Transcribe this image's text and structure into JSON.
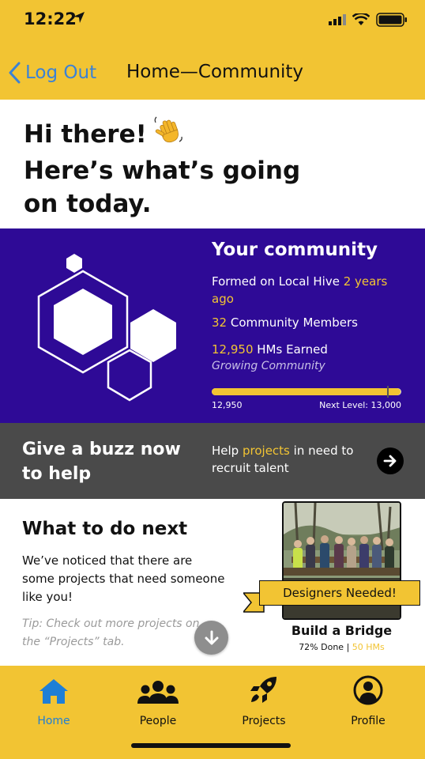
{
  "status_bar": {
    "time": "12:22"
  },
  "nav": {
    "back_label": "Log Out",
    "title": "Home—Community"
  },
  "greeting": {
    "line1": "Hi there!",
    "line2": "Here’s what’s going",
    "line3": "on today."
  },
  "community": {
    "title": "Your community",
    "formed_prefix": "Formed on Local Hive",
    "formed_age": "2 years ago",
    "members_count": "32",
    "members_label": "Community Members",
    "hms_count": "12,950",
    "hms_label": "HMs Earned",
    "status": "Growing Community",
    "progress_current": "12,950",
    "progress_next": "Next Level: 13,000",
    "progress_fraction": 0.9962
  },
  "buzz": {
    "title": "Give a buzz now to help",
    "text_prefix": "Help",
    "text_link": "projects",
    "text_suffix": "in need to recruit talent"
  },
  "next": {
    "title": "What to do next",
    "body": "We’ve noticed that there are some projects that need someone like you!",
    "tip": "Tip: Check out more projects on the “Projects” tab."
  },
  "project": {
    "ribbon": "Designers Needed!",
    "name": "Build a Bridge",
    "done": "72% Done",
    "separator": "|",
    "hms": "50 HMs"
  },
  "tabs": [
    {
      "label": "Home",
      "icon": "home-icon"
    },
    {
      "label": "People",
      "icon": "people-icon"
    },
    {
      "label": "Projects",
      "icon": "rocket-icon"
    },
    {
      "label": "Profile",
      "icon": "profile-icon"
    }
  ],
  "colors": {
    "accent": "#F2C433",
    "community_bg": "#2E0A96",
    "buzz_bg": "#4A4A4A",
    "active_tab": "#1E7FD6",
    "link": "#3B82D6"
  }
}
